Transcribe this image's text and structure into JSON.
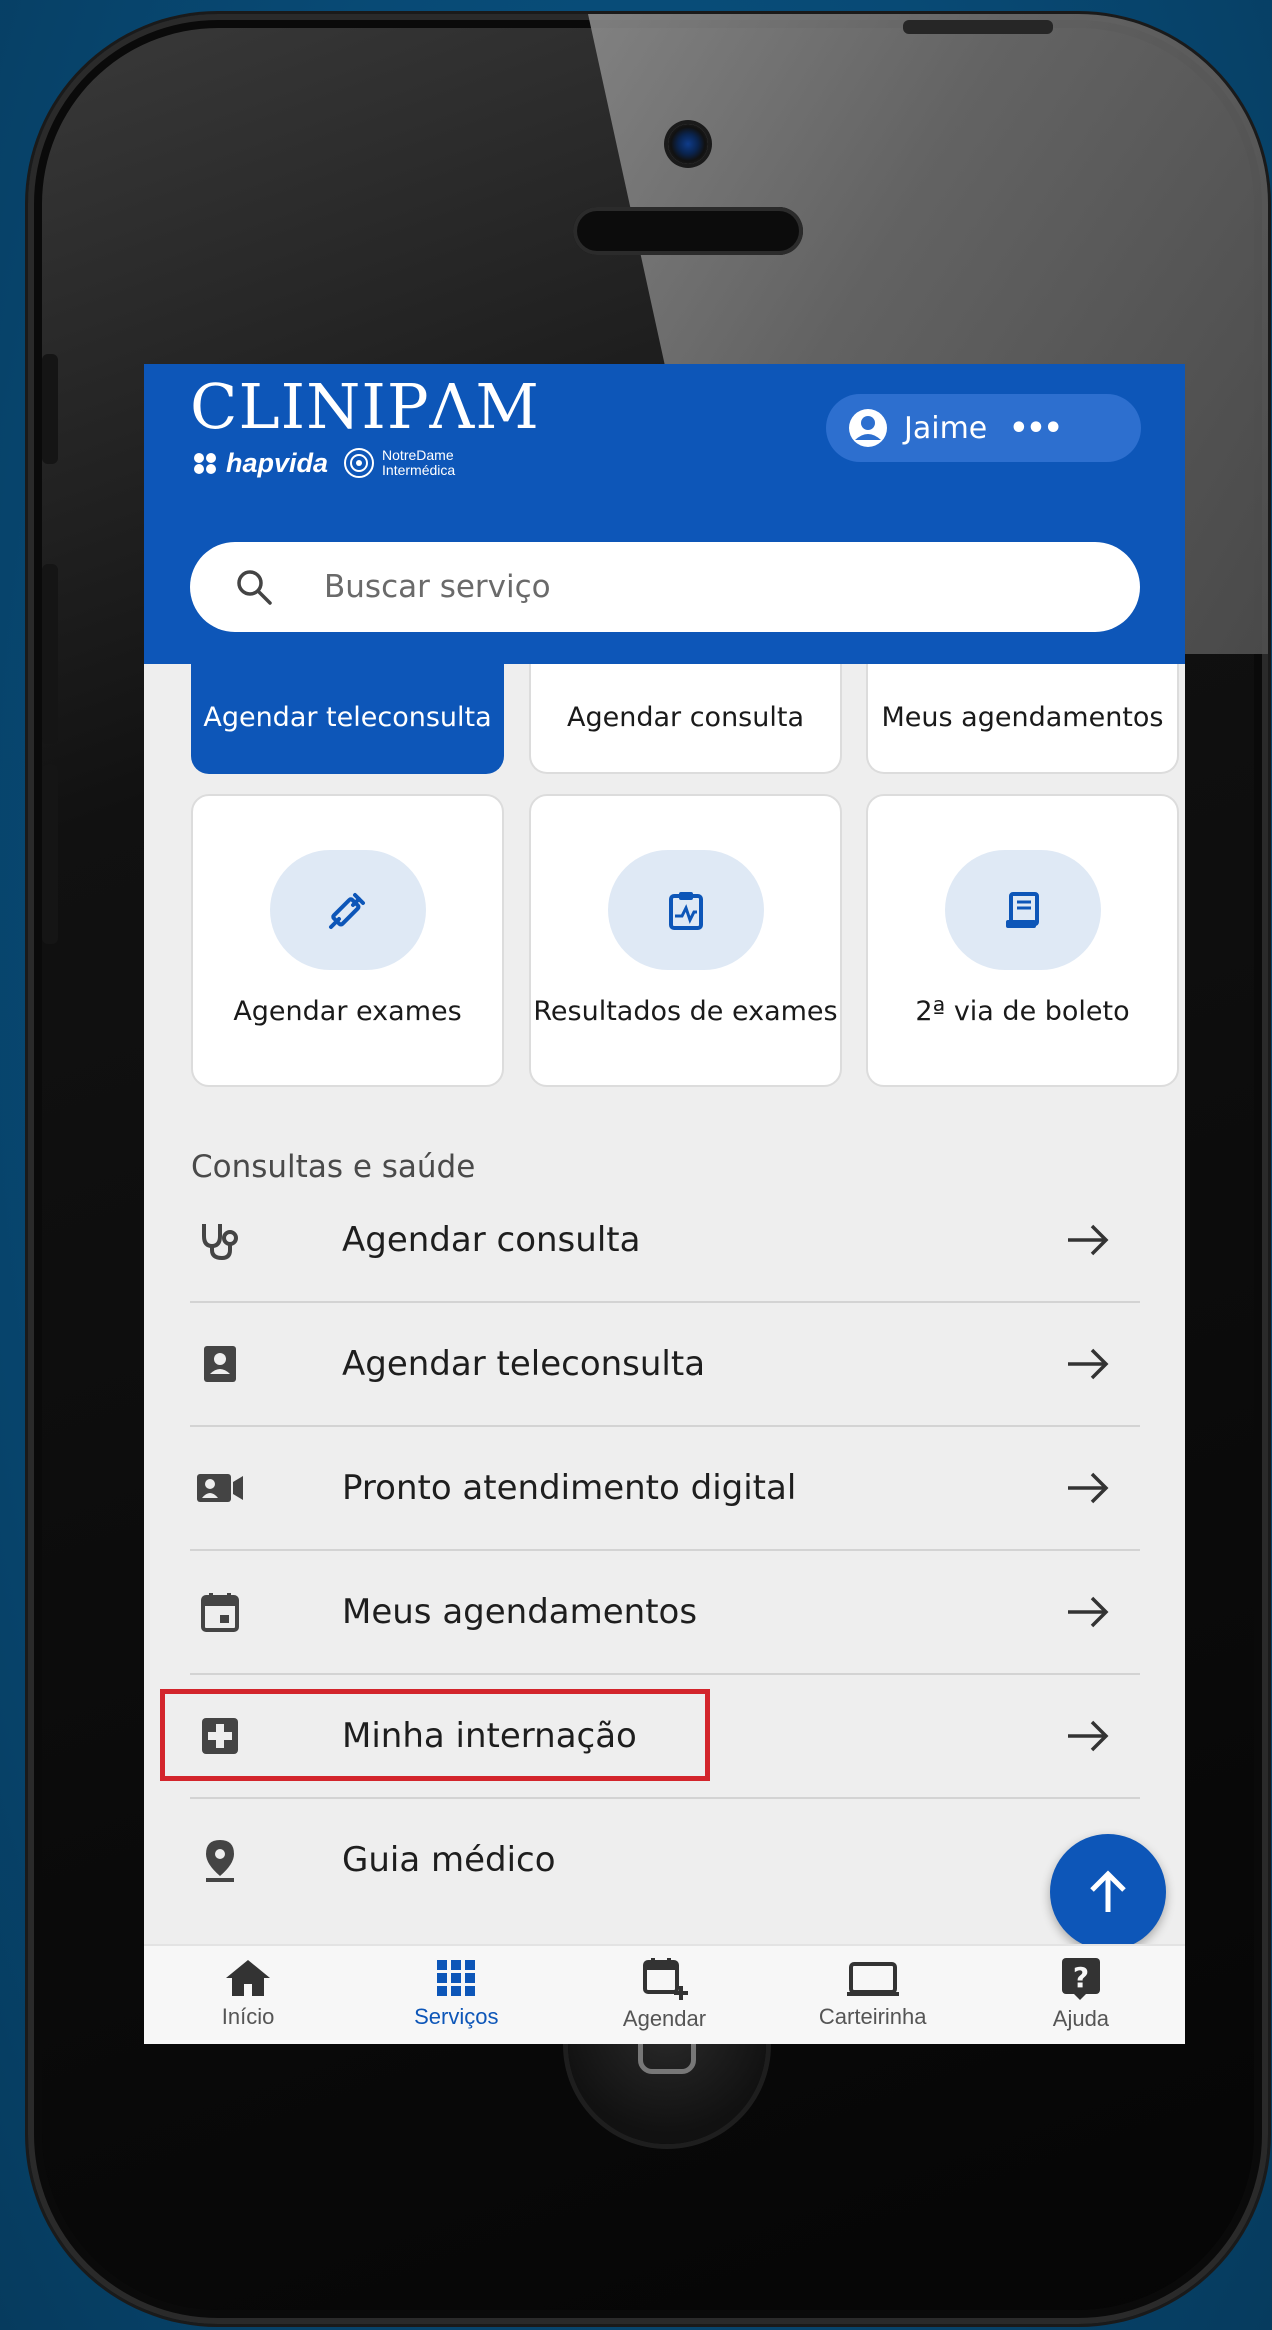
{
  "header": {
    "brand_name": "CLINIPΛM",
    "sub_brand_1": "hapvida",
    "sub_brand_2_line1": "NotreDame",
    "sub_brand_2_line2": "Intermédica",
    "user_name": "Jaime",
    "more_label": "•••"
  },
  "search": {
    "placeholder": "Buscar serviço"
  },
  "cards_row1": [
    {
      "label": "Agendar teleconsulta"
    },
    {
      "label": "Agendar consulta"
    },
    {
      "label": "Meus agendamentos"
    }
  ],
  "cards_row2": [
    {
      "label": "Agendar exames",
      "icon": "syringe-icon"
    },
    {
      "label": "Resultados de exames",
      "icon": "clipboard-chart-icon"
    },
    {
      "label": "2ª via de boleto",
      "icon": "receipt-icon"
    }
  ],
  "section": {
    "title": "Consultas e saúde"
  },
  "list": [
    {
      "label": "Agendar consulta",
      "icon": "stethoscope-icon"
    },
    {
      "label": "Agendar teleconsulta",
      "icon": "teleconsult-icon"
    },
    {
      "label": "Pronto atendimento digital",
      "icon": "video-call-icon"
    },
    {
      "label": "Meus agendamentos",
      "icon": "calendar-icon"
    },
    {
      "label": "Minha internação",
      "icon": "medical-cross-icon"
    },
    {
      "label": "Guia médico",
      "icon": "location-pin-icon"
    }
  ],
  "nav": [
    {
      "label": "Início",
      "icon": "home-icon"
    },
    {
      "label": "Serviços",
      "icon": "grid-icon",
      "active": true
    },
    {
      "label": "Agendar",
      "icon": "calendar-plus-icon"
    },
    {
      "label": "Carteirinha",
      "icon": "card-icon"
    },
    {
      "label": "Ajuda",
      "icon": "help-icon"
    }
  ],
  "colors": {
    "primary": "#0d56b8",
    "highlight": "#d3252c",
    "background": "#eeeeee"
  }
}
